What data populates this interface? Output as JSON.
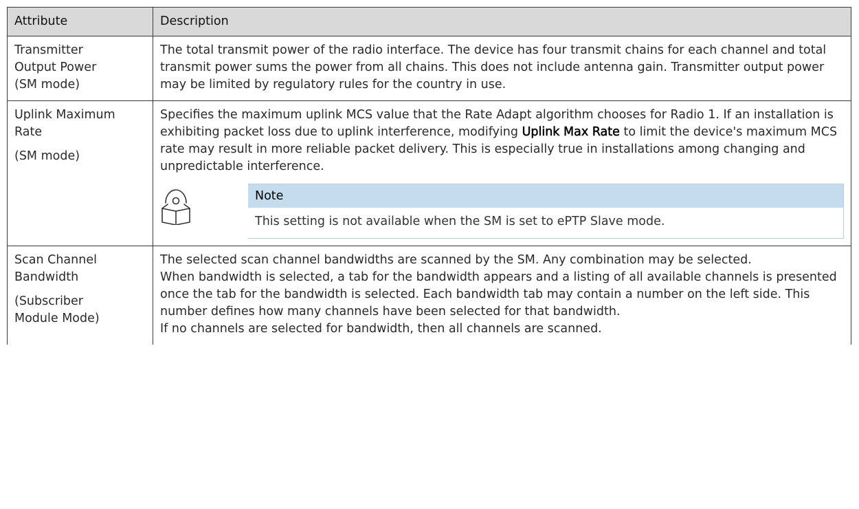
{
  "table": {
    "headers": [
      "Attribute",
      "Description"
    ],
    "rows": [
      {
        "attribute_lines": [
          "Transmitter",
          "Output Power",
          "(SM mode)"
        ],
        "description": "The total transmit power of the radio interface. The device has four transmit chains for each channel and total transmit power sums the power from all chains. This does not include antenna gain. Transmitter output power may be limited by regulatory rules for the country in use."
      },
      {
        "attribute_lines": [
          "Uplink Maximum",
          "Rate"
        ],
        "attribute_mode": "(SM mode)",
        "description_before": "Specifies the maximum uplink MCS value that the Rate Adapt algorithm chooses for Radio 1. If an installation is exhibiting packet loss due to uplink interference, modifying ",
        "description_bold": "Uplink Max Rate",
        "description_after": " to limit the device's maximum MCS rate may result in more reliable packet delivery. This is especially true in installations among changing and unpredictable interference.",
        "note": {
          "icon": "note-book-icon",
          "title": "Note",
          "text": "This setting is not available when the SM is set to ePTP Slave mode."
        }
      },
      {
        "attribute_lines": [
          "Scan Channel",
          "Bandwidth"
        ],
        "attribute_mode_lines": [
          "(Subscriber",
          "Module Mode)"
        ],
        "description_paragraphs": [
          "The selected scan channel bandwidths are scanned by the SM. Any combination may be selected.",
          "When bandwidth is selected, a tab for the bandwidth appears and a listing of all available channels is presented once the tab for the bandwidth is selected. Each bandwidth tab may contain a number on the left side. This number defines how many channels have been selected for that bandwidth.",
          "If no channels are selected for bandwidth, then all channels are scanned."
        ]
      }
    ]
  }
}
